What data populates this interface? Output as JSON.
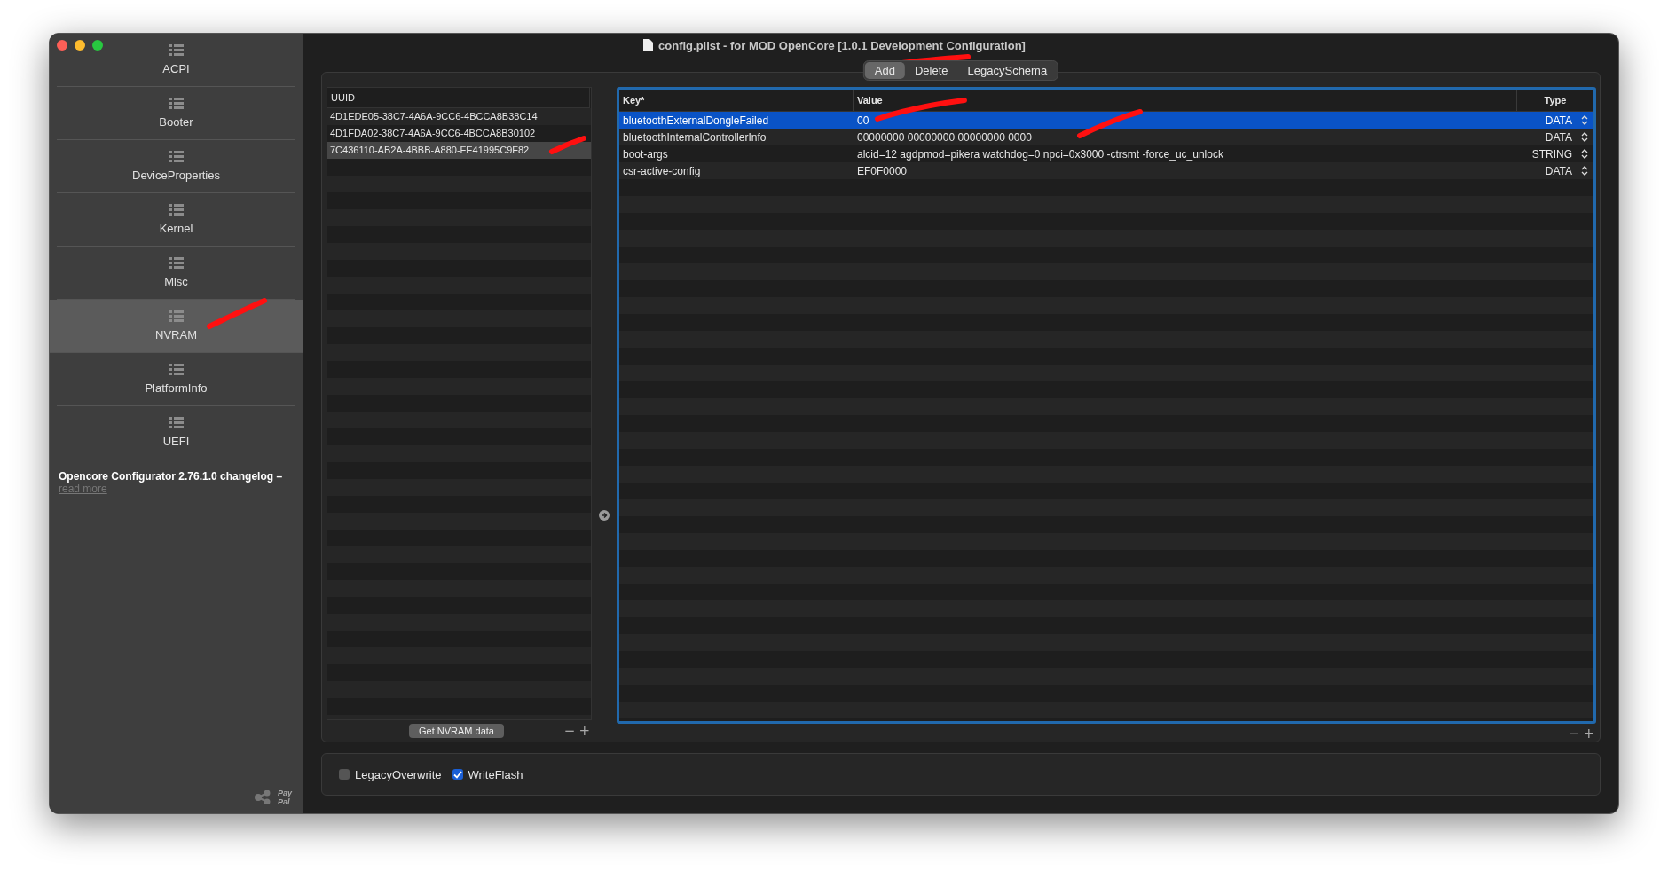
{
  "window": {
    "title": "config.plist - for MOD OpenCore [1.0.1 Development Configuration]"
  },
  "sidebar": {
    "items": [
      {
        "label": "ACPI",
        "selected": false
      },
      {
        "label": "Booter",
        "selected": false
      },
      {
        "label": "DeviceProperties",
        "selected": false
      },
      {
        "label": "Kernel",
        "selected": false
      },
      {
        "label": "Misc",
        "selected": false
      },
      {
        "label": "NVRAM",
        "selected": true
      },
      {
        "label": "PlatformInfo",
        "selected": false
      },
      {
        "label": "UEFI",
        "selected": false
      }
    ],
    "changelog": {
      "text": "Opencore Configurator 2.76.1.0 changelog –",
      "link": "read more"
    },
    "paypal_logo": [
      "Pay",
      "Pal"
    ]
  },
  "tabs": [
    {
      "label": "Add",
      "selected": true
    },
    {
      "label": "Delete",
      "selected": false
    },
    {
      "label": "LegacySchema",
      "selected": false
    }
  ],
  "uuid_list": {
    "column": "UUID",
    "rows": [
      {
        "uuid": "4D1EDE05-38C7-4A6A-9CC6-4BCCA8B38C14",
        "selected": false
      },
      {
        "uuid": "4D1FDA02-38C7-4A6A-9CC6-4BCCA8B30102",
        "selected": false
      },
      {
        "uuid": "7C436110-AB2A-4BBB-A880-FE41995C9F82",
        "selected": true
      }
    ],
    "button": "Get NVRAM data",
    "remove": "−",
    "add": "+"
  },
  "table": {
    "columns": [
      "Key*",
      "Value",
      "Type"
    ],
    "rows": [
      {
        "key": "bluetoothExternalDongleFailed",
        "value": "00",
        "type": "DATA",
        "selected": true
      },
      {
        "key": "bluetoothInternalControllerInfo",
        "value": "00000000 00000000 00000000 0000",
        "type": "DATA",
        "selected": false
      },
      {
        "key": "boot-args",
        "value": "alcid=12 agdpmod=pikera watchdog=0 npci=0x3000 -ctrsmt -force_uc_unlock",
        "type": "STRING",
        "selected": false
      },
      {
        "key": "csr-active-config",
        "value": "EF0F0000",
        "type": "DATA",
        "selected": false
      }
    ],
    "remove": "−",
    "add": "+"
  },
  "options": [
    {
      "label": "LegacyOverwrite",
      "checked": false
    },
    {
      "label": "WriteFlash",
      "checked": true
    }
  ]
}
